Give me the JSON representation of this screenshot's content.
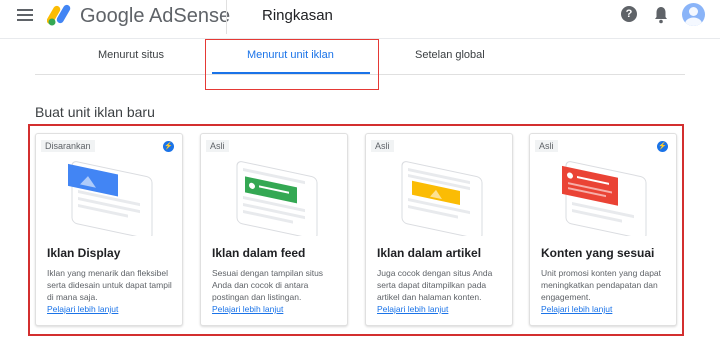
{
  "app": {
    "brand": "Google AdSense",
    "page_title": "Ringkasan"
  },
  "icons": {
    "menu": "hamburger-menu-icon",
    "help": "help-icon",
    "notifications": "bell-icon",
    "account": "avatar"
  },
  "colors": {
    "accent": "#1a73e8",
    "highlight_box": "#e53935",
    "display_illus": "#4285f4",
    "feed_illus": "#34a853",
    "article_illus": "#fbbc04",
    "matched_illus": "#ea4335"
  },
  "tabs": [
    {
      "label": "Menurut situs",
      "active": false
    },
    {
      "label": "Menurut unit iklan",
      "active": true
    },
    {
      "label": "Setelan global",
      "active": false
    }
  ],
  "section": {
    "title": "Buat unit iklan baru"
  },
  "cards": [
    {
      "badge": "Disarankan",
      "title": "Iklan Display",
      "description": "Iklan yang menarik dan fleksibel serta didesain untuk dapat tampil di mana saja.",
      "link": "Pelajari lebih lanjut"
    },
    {
      "badge": "Asli",
      "title": "Iklan dalam feed",
      "description": "Sesuai dengan tampilan situs Anda dan cocok di antara postingan dan listingan.",
      "link": "Pelajari lebih lanjut"
    },
    {
      "badge": "Asli",
      "title": "Iklan dalam artikel",
      "description": "Juga cocok dengan situs Anda serta dapat ditampilkan pada artikel dan halaman konten.",
      "link": "Pelajari lebih lanjut"
    },
    {
      "badge": "Asli",
      "title": "Konten yang sesuai",
      "description": "Unit promosi konten yang dapat meningkatkan pendapatan dan engagement.",
      "link": "Pelajari lebih lanjut"
    }
  ]
}
